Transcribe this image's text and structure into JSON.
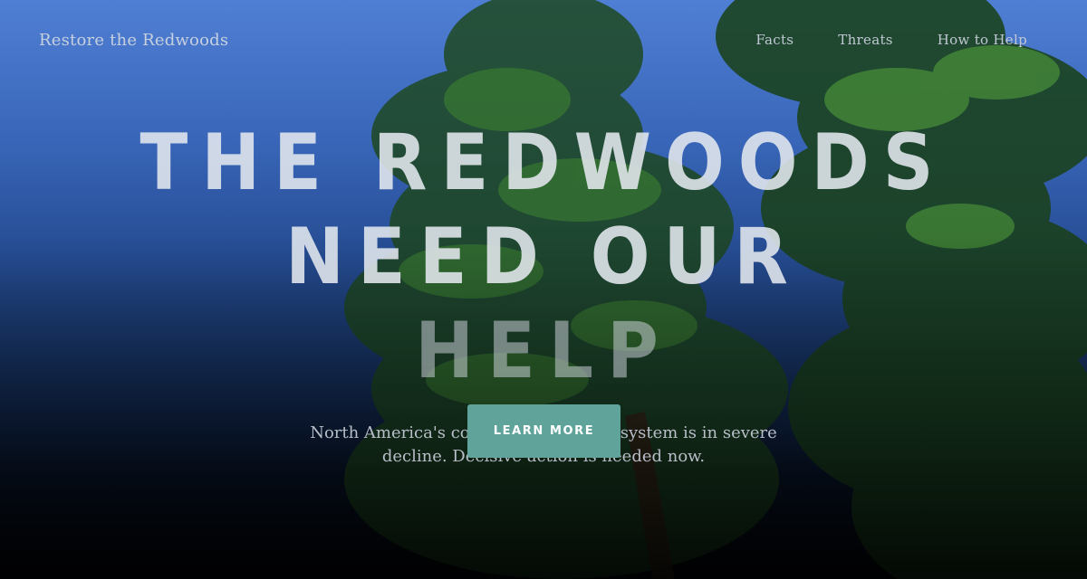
{
  "nav": {
    "brand": "Restore the Redwoods",
    "links": [
      "Facts",
      "Threats",
      "How to Help"
    ]
  },
  "hero": {
    "title_line1": "THE REDWOODS NEED OUR",
    "title_line2": "HELP",
    "subtitle": "North America's coastal redwood ecosystem is in severe decline. Decisive action is needed now.",
    "cta_label": "LEARN MORE"
  },
  "colors": {
    "sky_top": "#4f7fd4",
    "sky_bottom": "#02050b",
    "foliage": "#2f6a2a",
    "cta": "#5fa39b"
  }
}
